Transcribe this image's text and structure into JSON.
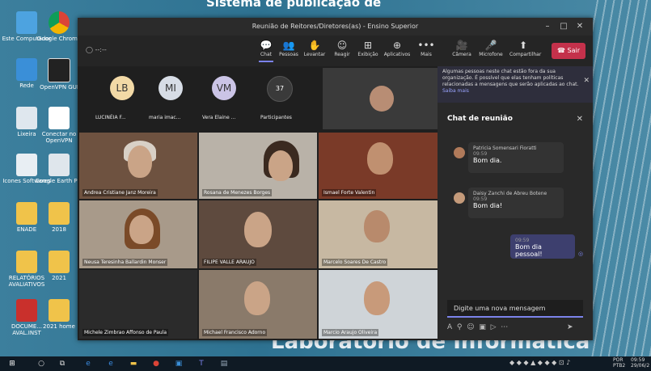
{
  "desktop": {
    "top_title": "Sistema de publicação de",
    "bottom_title": "Laboratório de Informática",
    "icons": [
      {
        "label": "Este Computador"
      },
      {
        "label": "Google Chrome"
      },
      {
        "label": "Rede"
      },
      {
        "label": "OpenVPN GUI"
      },
      {
        "label": "Lixeira"
      },
      {
        "label": "Conectar no OpenVPN"
      },
      {
        "label": "Icones Softwares"
      },
      {
        "label": "Google Earth Pro"
      },
      {
        "label": "ENADE"
      },
      {
        "label": "2018"
      },
      {
        "label": "RELATÓRIOS AVALIATIVOS"
      },
      {
        "label": "2021"
      },
      {
        "label": "DOCUME... AVAL.INST"
      },
      {
        "label": "2021 home"
      }
    ]
  },
  "window": {
    "title": "Reunião de Reitores/Diretores(as) - Ensino Superior",
    "timer": "--:--",
    "toolbar": [
      {
        "label": "Chat",
        "icon": "chat-icon",
        "glyph": "💬"
      },
      {
        "label": "Pessoas",
        "icon": "people-icon",
        "glyph": "👥"
      },
      {
        "label": "Levantar",
        "icon": "raise-hand-icon",
        "glyph": "✋"
      },
      {
        "label": "Reagir",
        "icon": "react-icon",
        "glyph": "☺"
      },
      {
        "label": "Exibição",
        "icon": "view-icon",
        "glyph": "⊞"
      },
      {
        "label": "Aplicativos",
        "icon": "apps-icon",
        "glyph": "⊕"
      },
      {
        "label": "Mais",
        "icon": "more-icon",
        "glyph": "•••"
      },
      {
        "label": "Câmera",
        "icon": "camera-off-icon",
        "glyph": "🎥"
      },
      {
        "label": "Microfone",
        "icon": "mic-off-icon",
        "glyph": "🎤"
      },
      {
        "label": "Compartilhar",
        "icon": "share-icon",
        "glyph": "⬆"
      }
    ],
    "leave_label": "Sair"
  },
  "participants_row": [
    {
      "initials": "LB",
      "name": "LUCINÉIA F...",
      "color": "#f2d9a6"
    },
    {
      "initials": "MI",
      "name": "maria imac...",
      "color": "#d7dde6"
    },
    {
      "initials": "VM",
      "name": "Vera Elaine ...",
      "color": "#cbc4e6"
    },
    {
      "initials": "37",
      "name": "Participantes",
      "color": "#3a3a3a"
    }
  ],
  "video_tiles": [
    {
      "name": "Andrea Cristiane Janz Moreira"
    },
    {
      "name": "Rosana de Menezes Borges"
    },
    {
      "name": "Ismael Forte Valentin"
    },
    {
      "name": "Neusa Teresinha Ballardin Monser"
    },
    {
      "name": "FILIPE VALLE ARAUJO"
    },
    {
      "name": "Marcelo Soares De Castro"
    },
    {
      "name": "Michele Zimbrao Affonso de Paula"
    },
    {
      "name": "Michael Francisco Adorno"
    },
    {
      "name": "Marcio Araujo Oliveira"
    }
  ],
  "notice": {
    "text": "Algumas pessoas neste chat estão fora da sua organização. É possível que elas tenham políticas relacionadas a mensagens que serão aplicadas ao chat.",
    "link": "Saiba mais"
  },
  "chat": {
    "title": "Chat de reunião",
    "messages": [
      {
        "author": "Patricia Somensari Fioratti",
        "time": "09:59",
        "text": "Bom dia."
      },
      {
        "author": "Daisy Zanchi de Abreu Botene",
        "time": "09:59",
        "text": "Bom dia!"
      },
      {
        "author": "",
        "time": "09:59",
        "text": "Bom dia pessoal!"
      }
    ],
    "input_placeholder": "Digite uma nova mensagem"
  },
  "taskbar": {
    "lang": "POR",
    "sub": "PTB2",
    "time": "09:59",
    "date": "29/06/2"
  }
}
